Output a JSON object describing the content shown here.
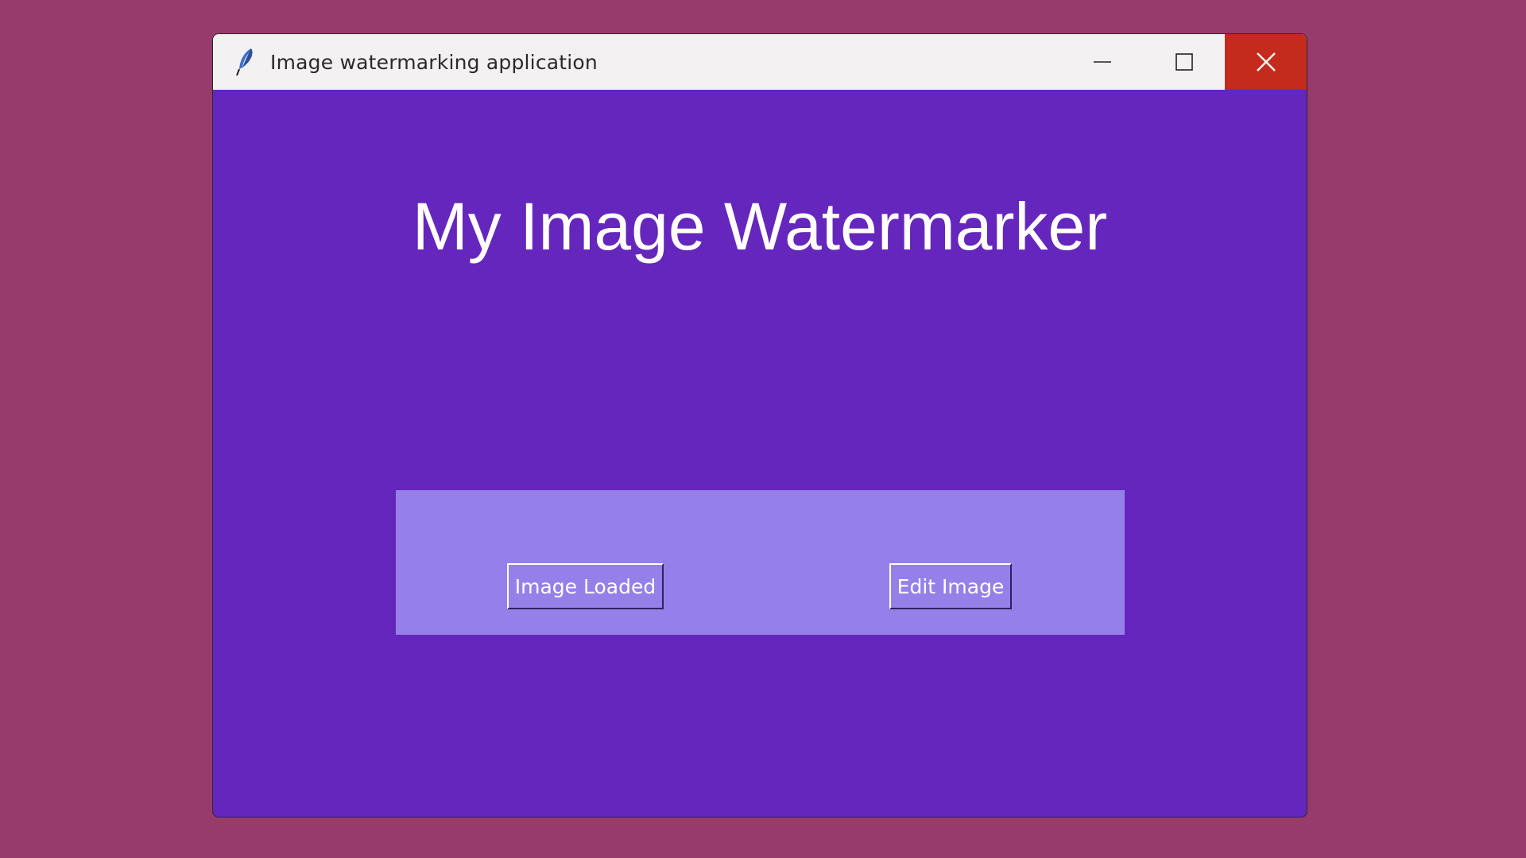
{
  "window": {
    "title": "Image watermarking application",
    "app_icon": "feather-icon",
    "controls": {
      "minimize_icon": "minimize-icon",
      "maximize_icon": "maximize-icon",
      "close_icon": "close-icon"
    }
  },
  "main": {
    "heading": "My Image Watermarker"
  },
  "panel": {
    "load_button_label": "Image Loaded",
    "edit_button_label": "Edit Image"
  },
  "colors": {
    "desktop_background": "#963b6b",
    "window_background": "#6526bd",
    "panel_background": "#9580ea",
    "close_button": "#c42b1c"
  }
}
